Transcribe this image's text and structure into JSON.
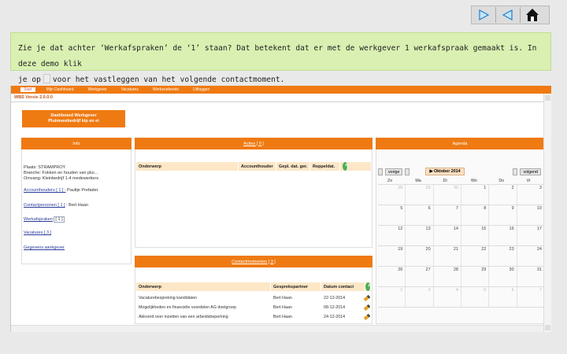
{
  "nav": {
    "icons": [
      "play-forward-icon",
      "play-back-icon",
      "home-icon"
    ]
  },
  "tip": {
    "line1": "Zie je dat achter ‘Werkafspraken’ de ‘1’ staan? Dat betekent dat er met de werkgever 1 werkafspraak gemaakt is. In deze demo klik",
    "line2_before": "je op",
    "line2_after": "voor het vastleggen van het volgende contactmoment."
  },
  "app": {
    "menu": [
      "Start",
      "Mijn Dashboard",
      "Werkgever",
      "Vacatures",
      "Werkzoekende",
      "Uitloggen"
    ],
    "version": "WBS Versie 2.0.0.0",
    "dashboard_title": [
      "Dashboard Werkgever",
      "Pluimveebedrijf kip en ei"
    ],
    "info": {
      "header": "Info",
      "lines": [
        "Plaats: STRAMPROY",
        "Branche: Fokken en houden van plui...",
        "Omvang: Kleinbedrijf 1-4 medewerkers"
      ],
      "accounthouders": "Accounthouders [ 1 ] :",
      "accounthouder_name": "Paultje Prefader",
      "contactpersonen": "Contactpersonen [ 1 ]",
      "contactpersoon_name": ": Bert Haan",
      "werkafspraken": "Werkafspraken",
      "werkafspraken_count": "[ 1 ]",
      "vacatures": "Vacatures [ 3 ]",
      "gegevens": "Gegevens werkgever"
    },
    "acties": {
      "header": "Acties [ 0 ]",
      "columns": [
        "Onderwerp",
        "Accounthouder",
        "Gepl. dat. ger.",
        "Reppeldat."
      ]
    },
    "contactmomenten": {
      "header": "Contactmomenten [ 3 ]",
      "columns": [
        "Onderwerp",
        "Gesprekspartner",
        "Datum contact"
      ],
      "rows": [
        [
          "Vacaturebespreking kandidaten",
          "Bert Haan",
          "22-12-2014"
        ],
        [
          "Mogelijkheden en financiële voordelen AG doelgroep",
          "Bert Haan",
          "08-12-2014"
        ],
        [
          "Akkoord over inzetten van een arbeidsbeperking",
          "Bert Haan",
          "24-12-2014"
        ]
      ]
    },
    "agenda": {
      "header": "Agenda",
      "prev": "vorige",
      "month": "Oktober 2014",
      "next": "volgend",
      "days": [
        "Zo",
        "Ma",
        "Di",
        "Wo",
        "Do",
        "Vr"
      ],
      "weeks": [
        [
          "28",
          "29",
          "30",
          "1",
          "2",
          "3"
        ],
        [
          "5",
          "6",
          "7",
          "8",
          "9",
          "10"
        ],
        [
          "12",
          "13",
          "14",
          "15",
          "16",
          "17"
        ],
        [
          "19",
          "20",
          "21",
          "22",
          "23",
          "24"
        ],
        [
          "26",
          "27",
          "28",
          "29",
          "30",
          "31"
        ],
        [
          "2",
          "3",
          "4",
          "5",
          "6",
          "7"
        ]
      ]
    }
  }
}
